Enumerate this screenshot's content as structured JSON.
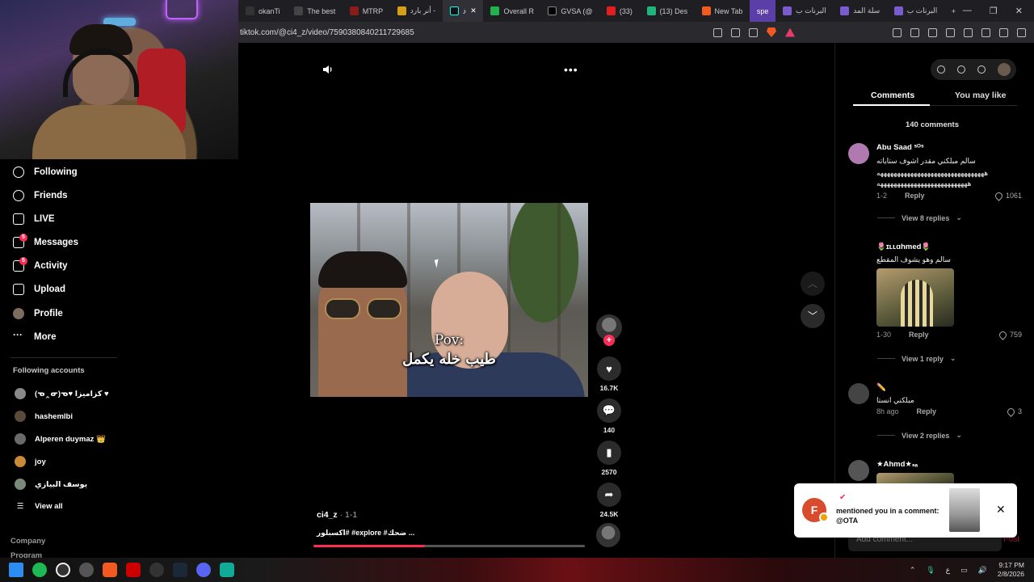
{
  "browser": {
    "tabs": [
      {
        "label": "okanTi",
        "color": "#333"
      },
      {
        "label": "The best",
        "color": "#444"
      },
      {
        "label": "MTRP",
        "color": "#8a1c1c"
      },
      {
        "label": "أنر بارد -",
        "color": "#d4a017"
      },
      {
        "label": "",
        "color": "#111"
      },
      {
        "label": "Overall R",
        "color": "#22b14c"
      },
      {
        "label": "GVSA (@",
        "color": "#000"
      },
      {
        "label": "(33)",
        "color": "#e02020"
      },
      {
        "label": "(13) Des",
        "color": "#1fb57a"
      },
      {
        "label": "New Tab",
        "color": "#f25a22"
      },
      {
        "label": "spe",
        "color": "#7a5cd0"
      },
      {
        "label": "البرنات ب",
        "color": "#7a5cd0"
      },
      {
        "label": "سلة المد",
        "color": "#7a5cd0"
      },
      {
        "label": "البرنات ب",
        "color": "#7a5cd0"
      }
    ],
    "new_tab": "+",
    "url": "tiktok.com/@ci4_z/video/7590380840211729685"
  },
  "nav": {
    "items": [
      {
        "label": "Following",
        "icon": "following-icon"
      },
      {
        "label": "Friends",
        "icon": "friends-icon"
      },
      {
        "label": "LIVE",
        "icon": "live-icon"
      },
      {
        "label": "Messages",
        "icon": "messages-icon",
        "badge": "5"
      },
      {
        "label": "Activity",
        "icon": "activity-icon",
        "badge": "5"
      },
      {
        "label": "Upload",
        "icon": "upload-icon"
      },
      {
        "label": "Profile",
        "icon": "profile-icon"
      },
      {
        "label": "More",
        "icon": "more-icon"
      }
    ],
    "following_title": "Following accounts",
    "accounts": [
      {
        "name": "(ᓀ‸ᓂ)ᓀ♥ كزاميزا ♥",
        "color": "#8a8a8a"
      },
      {
        "name": "hashemlbi",
        "color": "#5a4a3a"
      },
      {
        "name": "Alperen duymaz 👑",
        "color": "#6a6a6a"
      },
      {
        "name": "joy",
        "color": "#c98a3a"
      },
      {
        "name": "يوسف البيازي",
        "color": "#7a8a7a"
      }
    ],
    "view_all": "View all",
    "footer": [
      "Company",
      "Program"
    ]
  },
  "video": {
    "caption_line1": "Pov:",
    "caption_line2": "طيب خله يكمل",
    "likes": "16.7K",
    "comments": "140",
    "saves": "2570",
    "shares": "24.5K",
    "author": "ci4_z",
    "date": " · 1-1",
    "description": "اكسبلور# #explore #ضحك ...",
    "progress": 0.41
  },
  "panel": {
    "tab_comments": "Comments",
    "tab_like": "You may like",
    "count": "140 comments",
    "comments": [
      {
        "name": "Abu Saad ˢᴼˢ",
        "text1": "سالم مبلكني مقدر اشوف ستاياته",
        "text2": "ههههههههههههههههههههههههههههههههه",
        "text3": "هههههههههههههههههههههههههههه",
        "date": "1-2",
        "reply": "Reply",
        "likes": "1061",
        "view": "View 8 replies",
        "av": "#b07ab0"
      },
      {
        "name": "🌷ɪʟʟɑhmed🌷",
        "text1": "سالم وهو يشوف المقطع",
        "date": "1-30",
        "reply": "Reply",
        "likes": "759",
        "view": "View 1 reply",
        "av": "#000"
      },
      {
        "name": "✏️",
        "text1": "مبلكني انستا",
        "date": "8h ago",
        "reply": "Reply",
        "likes": "3",
        "view": "View 2 replies",
        "av": "#444"
      },
      {
        "name": "★Ahmd★ₛₐ",
        "av": "#555"
      }
    ],
    "add_comment": "Add comment...",
    "post": "Post"
  },
  "toast": {
    "avatar_letter": "F",
    "text": "mentioned you in a comment: @OTA",
    "close": "✕"
  },
  "taskbar": {
    "lang": "ع",
    "time": "9:17 PM",
    "date": "2/8/2026"
  }
}
